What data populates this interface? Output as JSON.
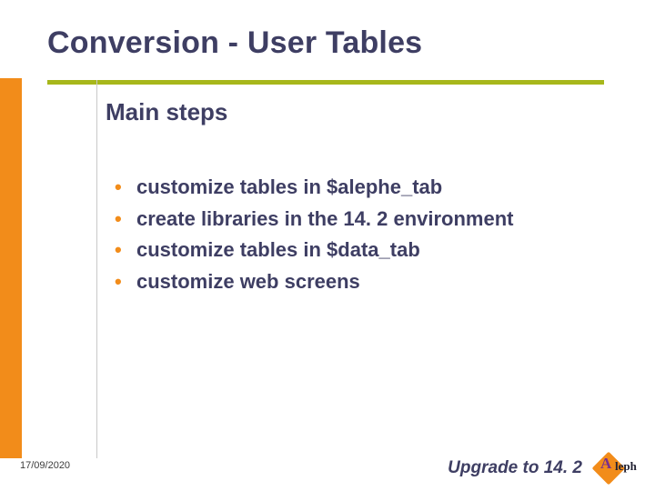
{
  "title": "Conversion - User Tables",
  "subtitle": "Main steps",
  "bullets": [
    "customize tables in $alephe_tab",
    "create libraries in the 14. 2 environment",
    "customize tables in $data_tab",
    "customize web screens"
  ],
  "footer": {
    "date": "17/09/2020",
    "subtitle": "Upgrade to 14. 2",
    "logo_a": "A",
    "logo_rest": "leph"
  }
}
